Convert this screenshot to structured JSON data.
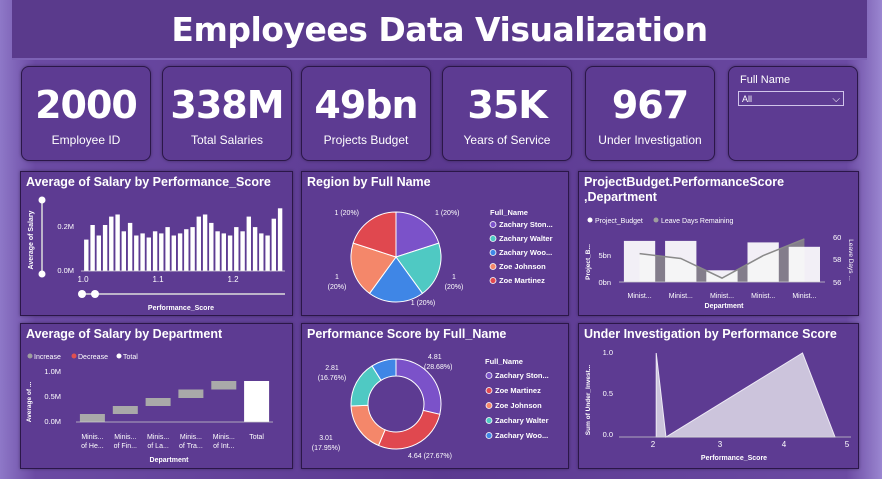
{
  "title": "Employees Data Visualization",
  "kpis": [
    {
      "value": "2000",
      "label": "Employee ID"
    },
    {
      "value": "338M",
      "label": "Total Salaries"
    },
    {
      "value": "49bn",
      "label": "Projects Budget"
    },
    {
      "value": "35K",
      "label": "Years of Service"
    },
    {
      "value": "967",
      "label": "Under Investigation"
    }
  ],
  "slicer": {
    "label": "Full Name",
    "selected": "All"
  },
  "colors": {
    "page": "#5a3a8c",
    "bar_white": "#ffffff",
    "series_grey": "#9e9e9e",
    "decrease": "#e05050"
  },
  "legend_items": [
    "Zachary Ston...",
    "Zachary Walter",
    "Zachary Woo...",
    "Zoe Johnson",
    "Zoe Martinez"
  ],
  "charts": {
    "salary_perf": {
      "title": "Average of Salary by Performance_Score",
      "ylabel": "Average of Salary",
      "xlabel": "Performance_Score",
      "yticks": [
        "0.2M",
        "0.0M"
      ],
      "xticks": [
        "1.0",
        "1.1",
        "1.2"
      ]
    },
    "region": {
      "title": "Region by Full Name",
      "legend_title": "Full_Name",
      "labels": [
        "1 (20%)",
        "1 (20%)",
        "1\n(20%)",
        "1 (20%)",
        "1\n(20%)"
      ]
    },
    "project_budget": {
      "title_line1": "ProjectBudget.PerformanceScore",
      "title_line2": ",Department",
      "legend": [
        "Project_Budget",
        "Leave Days Remaining"
      ],
      "ylabel_left": "Project_B...",
      "ylabel_right": "Leave Days ...",
      "yticks_left": [
        "5bn",
        "0bn"
      ],
      "yticks_right": [
        "60",
        "58",
        "56"
      ],
      "xticks": [
        "Minist...",
        "Minist...",
        "Minist...",
        "Minist...",
        "Minist..."
      ],
      "xlabel": "Department"
    },
    "salary_dept": {
      "title": "Average of Salary by Department",
      "legend": [
        "Increase",
        "Decrease",
        "Total"
      ],
      "ylabel": "Average of ...",
      "yticks": [
        "1.0M",
        "0.5M",
        "0.0M"
      ],
      "xticks": [
        [
          "Minis...",
          "of He..."
        ],
        [
          "Minis...",
          "of Fin..."
        ],
        [
          "Minis...",
          "of La..."
        ],
        [
          "Minis...",
          "of Tra..."
        ],
        [
          "Minis...",
          "of Int..."
        ],
        [
          "Total",
          ""
        ]
      ],
      "xlabel": "Department"
    },
    "perf_name": {
      "title": "Performance Score by Full_Name",
      "legend_title": "Full_Name",
      "legend": [
        "Zachary Ston...",
        "Zoe Martinez",
        "Zoe Johnson",
        "Zachary Walter",
        "Zachary Woo..."
      ],
      "labels": [
        "4.81\n(28.68%)",
        "4.64 (27.67%)",
        "3.01\n(17.95%)",
        "2.81\n(16.76%)"
      ]
    },
    "under_inv": {
      "title": "Under Investigation by Performance Score",
      "ylabel": "Sum of Under_Invest...",
      "xlabel": "Performance_Score",
      "yticks": [
        "1.0",
        "0.5",
        "0.0"
      ],
      "xticks": [
        "2",
        "3",
        "4",
        "5"
      ]
    }
  },
  "chart_data": [
    {
      "type": "bar",
      "title": "Average of Salary by Performance_Score",
      "xlabel": "Performance_Score",
      "ylabel": "Average of Salary",
      "xlim": [
        0.98,
        1.3
      ],
      "ylim": [
        0,
        0.33
      ],
      "values": [
        0.15,
        0.22,
        0.17,
        0.22,
        0.26,
        0.27,
        0.19,
        0.23,
        0.17,
        0.18,
        0.16,
        0.19,
        0.18,
        0.21,
        0.17,
        0.18,
        0.2,
        0.21,
        0.26,
        0.27,
        0.23,
        0.19,
        0.18,
        0.17,
        0.21,
        0.19,
        0.26,
        0.21,
        0.18,
        0.17,
        0.25,
        0.3
      ]
    },
    {
      "type": "pie",
      "title": "Region by Full Name",
      "categories": [
        "Zachary Ston...",
        "Zachary Walter",
        "Zachary Woo...",
        "Zoe Johnson",
        "Zoe Martinez"
      ],
      "values": [
        1,
        1,
        1,
        1,
        1
      ]
    },
    {
      "type": "bar",
      "title": "ProjectBudget.PerformanceScore,Department",
      "categories": [
        "Minist...",
        "Minist...",
        "Minist...",
        "Minist...",
        "Minist..."
      ],
      "series": [
        {
          "name": "Project_Budget",
          "values": [
            5.6,
            5.6,
            1.6,
            5.4,
            4.8
          ]
        },
        {
          "name": "Leave Days Remaining",
          "values": [
            58.5,
            58.0,
            56.0,
            58.3,
            60.0
          ]
        }
      ]
    },
    {
      "type": "bar",
      "title": "Average of Salary by Department",
      "categories": [
        "Minis... of He...",
        "Minis... of Fin...",
        "Minis... of La...",
        "Minis... of Tra...",
        "Minis... of Int...",
        "Total"
      ],
      "values": [
        0.16,
        0.16,
        0.16,
        0.17,
        0.17,
        0.82
      ],
      "ylim": [
        0,
        1.2
      ]
    },
    {
      "type": "pie",
      "title": "Performance Score by Full_Name",
      "categories": [
        "Zachary Ston...",
        "Zoe Martinez",
        "Zoe Johnson",
        "Zachary Walter",
        "Zachary Woo..."
      ],
      "values": [
        4.81,
        4.64,
        3.01,
        2.81,
        1.5
      ]
    },
    {
      "type": "area",
      "title": "Under Investigation by Performance Score",
      "xlabel": "Performance_Score",
      "ylabel": "Sum of Under_Invest...",
      "xlim": [
        1.5,
        5.1
      ],
      "ylim": [
        0,
        1.05
      ],
      "x": [
        2.05,
        2.2,
        4.3,
        4.8
      ],
      "y": [
        1.0,
        0.0,
        1.0,
        0.0
      ]
    }
  ]
}
